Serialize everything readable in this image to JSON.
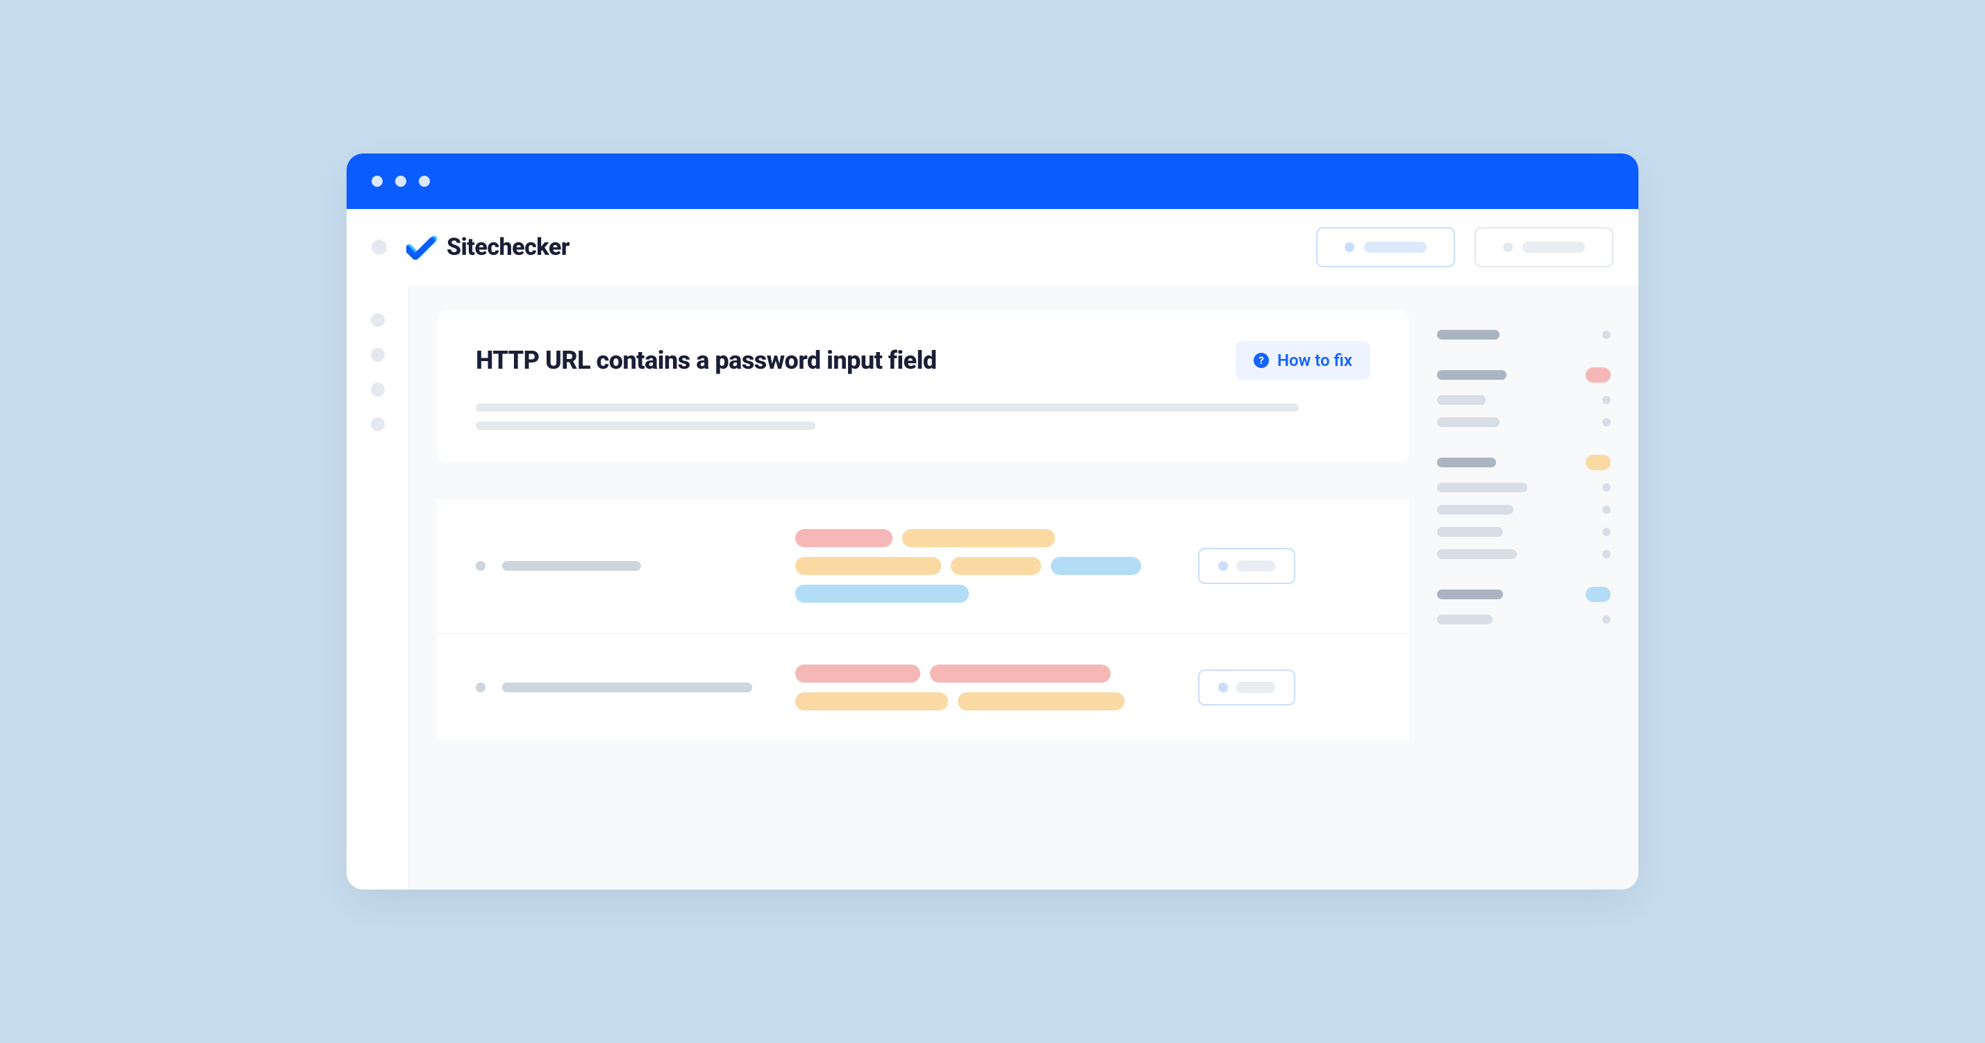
{
  "app": {
    "name": "Sitechecker"
  },
  "issue": {
    "title": "HTTP URL contains a password input field",
    "how_to_fix_label": "How to fix"
  },
  "colors": {
    "accent": "#0b5cff",
    "link": "#1663ff",
    "red": "#f6b7b7",
    "orange": "#fbd9a3",
    "blue": "#b3dcf6"
  }
}
